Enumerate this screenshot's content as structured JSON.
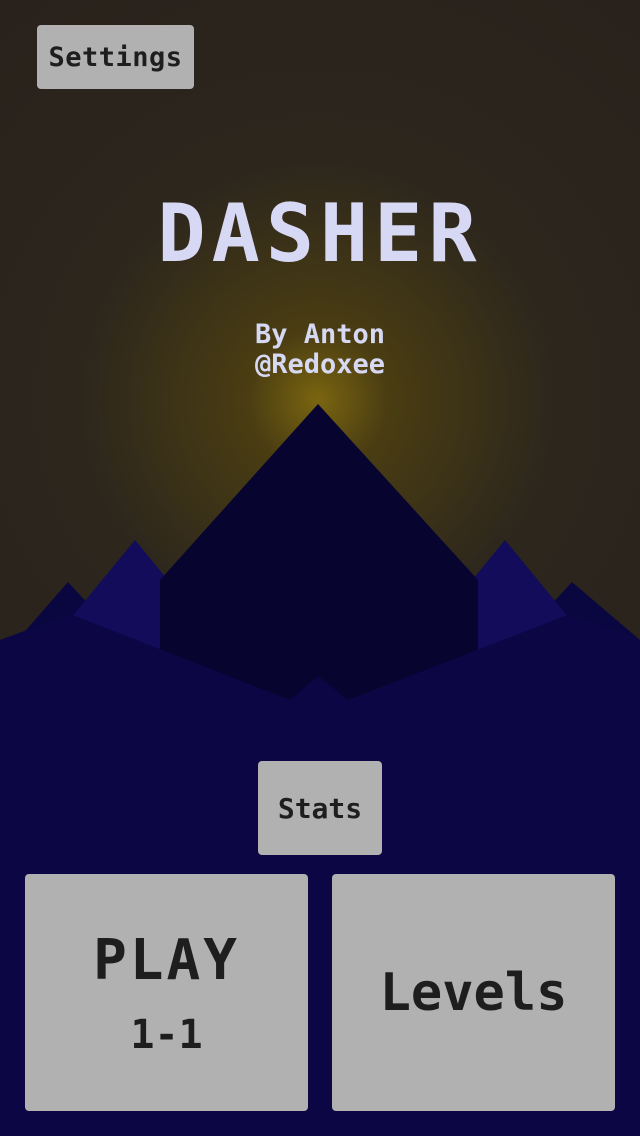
{
  "header": {
    "settings_label": "Settings"
  },
  "title": {
    "text": "DASHER",
    "credits_line1": "By Anton",
    "credits_line2": "@Redoxee"
  },
  "menu": {
    "stats_label": "Stats",
    "play_label": "PLAY",
    "play_level": "1-1",
    "levels_label": "Levels"
  },
  "colors": {
    "button_bg": "#b1b1b1",
    "button_text": "#1e1e1e",
    "title_text": "#d6d8f4",
    "ground": "#0c0645",
    "mountain_far": "#0e0a52",
    "mountain_near": "#070530",
    "sun_glow": "#7a6510"
  }
}
